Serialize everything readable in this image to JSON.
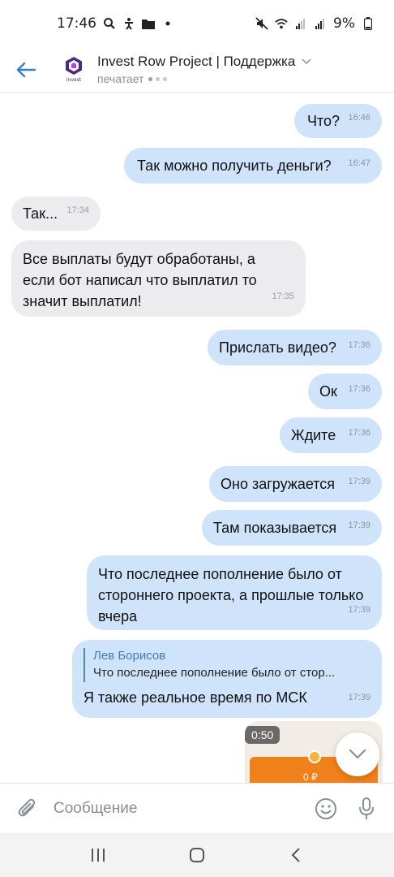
{
  "status_bar": {
    "time": "17:46",
    "battery": "9%",
    "left_icons": [
      "search-icon",
      "accessibility-icon",
      "folder-icon",
      "dot-icon"
    ],
    "right_icons": [
      "mute-icon",
      "wifi-icon",
      "signal-icon",
      "signal-r-icon",
      "battery-icon"
    ]
  },
  "header": {
    "avatar_text": "invest",
    "title": "Invest Row Project | Поддержка",
    "subtitle": "печатает"
  },
  "messages": [
    {
      "dir": "out",
      "text": "Что?",
      "time": "16:46"
    },
    {
      "dir": "out",
      "text": "Так можно получить деньги?",
      "time": "16:47"
    },
    {
      "dir": "in",
      "text": "Так...",
      "time": "17:34"
    },
    {
      "dir": "in",
      "text": "Все выплаты будут обработаны, а если бот написал что выплатил то значит выплатил!",
      "time": "17:35"
    },
    {
      "dir": "out",
      "text": "Прислать видео?",
      "time": "17:36"
    },
    {
      "dir": "out",
      "text": "Ок",
      "time": "17:36"
    },
    {
      "dir": "out",
      "text": "Ждите",
      "time": "17:36"
    },
    {
      "dir": "out",
      "text": "Оно загружается",
      "time": "17:39"
    },
    {
      "dir": "out",
      "text": "Там показывается",
      "time": "17:39"
    },
    {
      "dir": "out",
      "text": "Что последнее пополнение было от стороннего проекта, а прошлые только вчера",
      "time": "17:39"
    },
    {
      "dir": "out",
      "reply_author": "Лев Борисов",
      "reply_text": "Что последнее пополнение было от стор...",
      "text": "Я также реальное время по МСК",
      "time": "17:39"
    }
  ],
  "video": {
    "duration": "0:50",
    "amount": "0 ₽"
  },
  "composer": {
    "placeholder": "Сообщение"
  },
  "colors": {
    "outgoing": "#cfe4fb",
    "incoming": "#ececef",
    "accent": "#3f7bbf"
  }
}
